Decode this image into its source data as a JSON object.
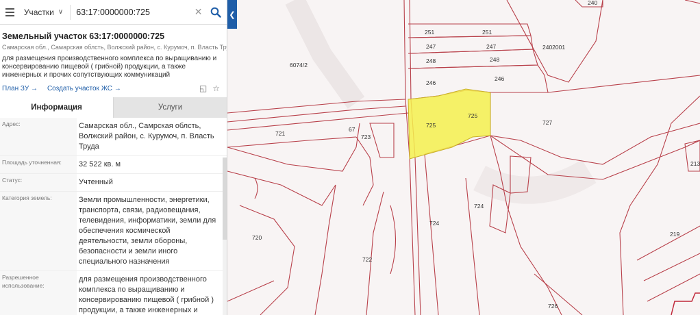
{
  "search": {
    "layer": "Участки",
    "query": "63:17:0000000:725"
  },
  "parcel": {
    "title": "Земельный участок 63:17:0000000:725",
    "address_short": "Самарская обл., Самарская облсть, Волжский район, с. Курумоч, п. Власть Труда",
    "purpose_short": "для размещения производственного комплекса по выращиванию и консервированию пищевой ( грибной) продукции, а также инженерных и прочих сопутствующих коммуникаций",
    "links": {
      "plan": "План ЗУ",
      "create": "Создать участок ЖС"
    }
  },
  "tabs": [
    "Информация",
    "Услуги"
  ],
  "rows": [
    {
      "label": "Адрес:",
      "value": "Самарская обл., Самрская облсть, Волжский район, с. Курумоч, п. Власть Труда"
    },
    {
      "label": "Площадь уточненная:",
      "value": "32 522 кв. м"
    },
    {
      "label": "Статус:",
      "value": "Учтенный"
    },
    {
      "label": "Категория земель:",
      "value": "Земли промышленности, энергетики, транспорта, связи, радиовещания, телевидения, информатики, земли для обеспечения космической деятельности, земли обороны, безопасности и земли иного специального назначения"
    },
    {
      "label": "Разрешенное использование:",
      "value": "для размещения производственного комплекса по выращиванию и консервированию пищевой ( грибной ) продукции, а также инженерных и"
    }
  ],
  "map_labels": {
    "l240": "240",
    "l251a": "251",
    "l251b": "251",
    "l247a": "247",
    "l247b": "247",
    "l248a": "248",
    "l248b": "248",
    "l246a": "246",
    "l246b": "246",
    "l2402001": "2402001",
    "l6074": "6074/2",
    "l725a": "725",
    "l725b": "725",
    "l727": "727",
    "l721": "721",
    "l67": "67",
    "l723": "723",
    "l724a": "724",
    "l724b": "724",
    "l720": "720",
    "l722": "722",
    "l726": "726",
    "l219": "219",
    "l213": "213"
  },
  "colors": {
    "accent": "#1f5ea8",
    "parcel_highlight": "#f5f04d",
    "boundary": "#b8404a"
  }
}
